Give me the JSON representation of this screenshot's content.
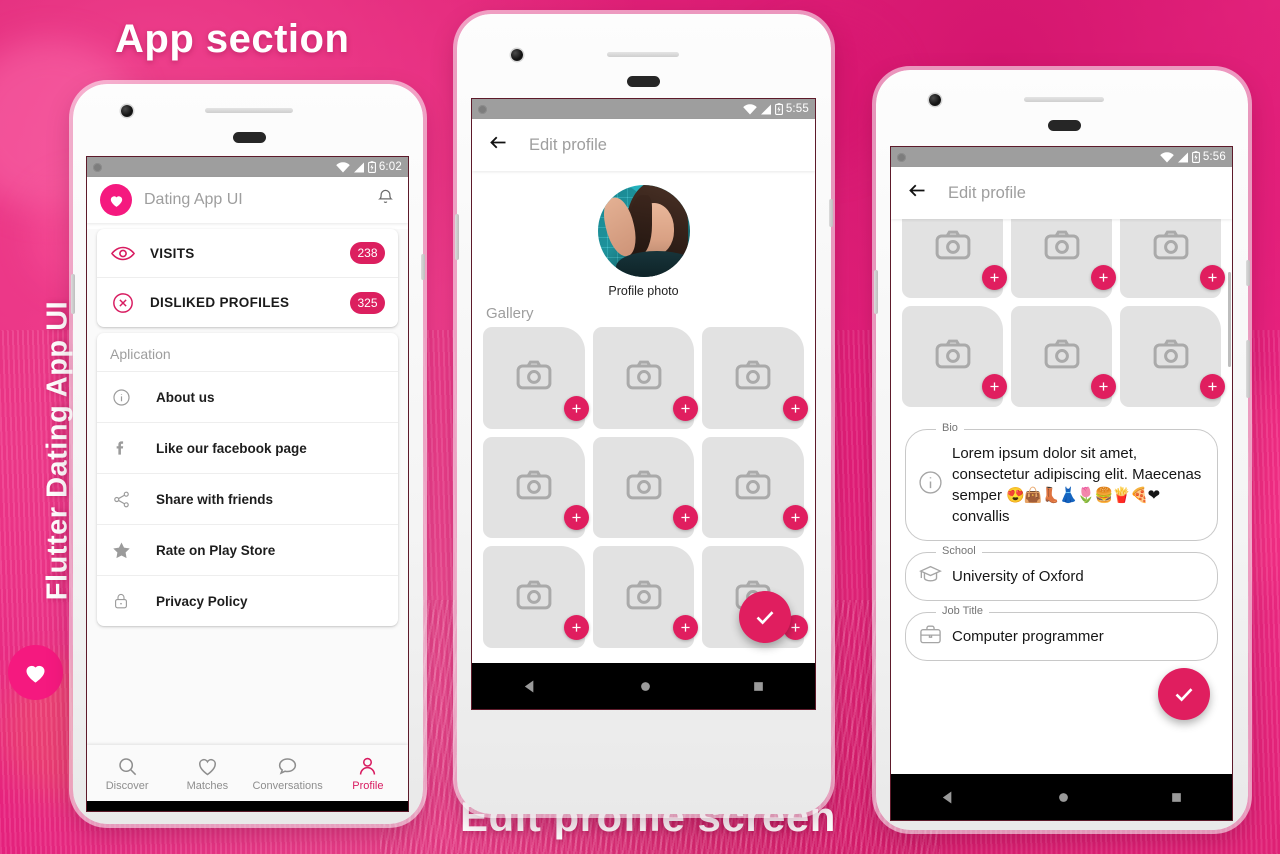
{
  "overlay": {
    "app_section_label": "App section",
    "edit_profile_label": "Edit profile screen",
    "side_label": "Flutter Dating App UI",
    "heart_icon": "heart-icon"
  },
  "theme": {
    "accent": "#dc1f5f",
    "logo_pink": "#f5197f",
    "background": "#e0197d",
    "muted_text": "#9e9e9e"
  },
  "phone1": {
    "statusbar": {
      "time": "6:02",
      "wifi_icon": "wifi-icon",
      "signal_icon": "signal-icon",
      "battery_icon": "battery-icon"
    },
    "appbar": {
      "logo": "heart-logo-icon",
      "title": "Dating App UI",
      "action_icon": "bell-icon"
    },
    "counters": [
      {
        "icon": "eye-icon",
        "label": "VISITS",
        "count": "238"
      },
      {
        "icon": "dislike-circle-icon",
        "label": "DISLIKED PROFILES",
        "count": "325"
      }
    ],
    "application_section": {
      "title": "Aplication",
      "items": [
        {
          "icon": "info-icon",
          "label": "About us"
        },
        {
          "icon": "facebook-icon",
          "label": "Like our facebook page"
        },
        {
          "icon": "share-icon",
          "label": "Share with friends"
        },
        {
          "icon": "star-icon",
          "label": "Rate on Play Store"
        },
        {
          "icon": "lock-icon",
          "label": "Privacy Policy"
        }
      ]
    },
    "bottom_nav": [
      {
        "icon": "search-icon",
        "label": "Discover",
        "active": false
      },
      {
        "icon": "heart-outline-icon",
        "label": "Matches",
        "active": false
      },
      {
        "icon": "chat-bubble-icon",
        "label": "Conversations",
        "active": false
      },
      {
        "icon": "person-icon",
        "label": "Profile",
        "active": true
      }
    ],
    "navbar": {
      "back": "triangle-back-icon",
      "home": "circle-home-icon",
      "recents": "square-recents-icon"
    }
  },
  "phone2": {
    "statusbar": {
      "time": "5:55",
      "wifi_icon": "wifi-icon",
      "signal_icon": "signal-icon",
      "battery_icon": "battery-icon"
    },
    "appbar": {
      "back_icon": "arrow-back-icon",
      "title": "Edit profile"
    },
    "profile_photo_caption": "Profile photo",
    "gallery_title": "Gallery",
    "gallery_tiles": 9,
    "tile_icon": "camera-icon",
    "add_icon": "plus-icon",
    "save_icon": "check-icon",
    "navbar": {
      "back": "triangle-back-icon",
      "home": "circle-home-icon",
      "recents": "square-recents-icon"
    }
  },
  "phone3": {
    "statusbar": {
      "time": "5:56",
      "wifi_icon": "wifi-icon",
      "signal_icon": "signal-icon",
      "battery_icon": "battery-icon"
    },
    "appbar": {
      "back_icon": "arrow-back-icon",
      "title": "Edit profile"
    },
    "gallery_tiles": 6,
    "tile_icon": "camera-icon",
    "add_icon": "plus-icon",
    "fields": [
      {
        "label": "Bio",
        "icon": "info-icon",
        "value": "Lorem ipsum dolor sit amet, consectetur adipiscing elit. Maecenas semper",
        "emoji": "😍👜👢👗🌷🍔🍟🍕❤",
        "value_tail": "convallis"
      },
      {
        "label": "School",
        "icon": "graduation-cap-icon",
        "value": "University of Oxford"
      },
      {
        "label": "Job Title",
        "icon": "briefcase-icon",
        "value": "Computer programmer"
      }
    ],
    "save_icon": "check-icon",
    "navbar": {
      "back": "triangle-back-icon",
      "home": "circle-home-icon",
      "recents": "square-recents-icon"
    }
  }
}
